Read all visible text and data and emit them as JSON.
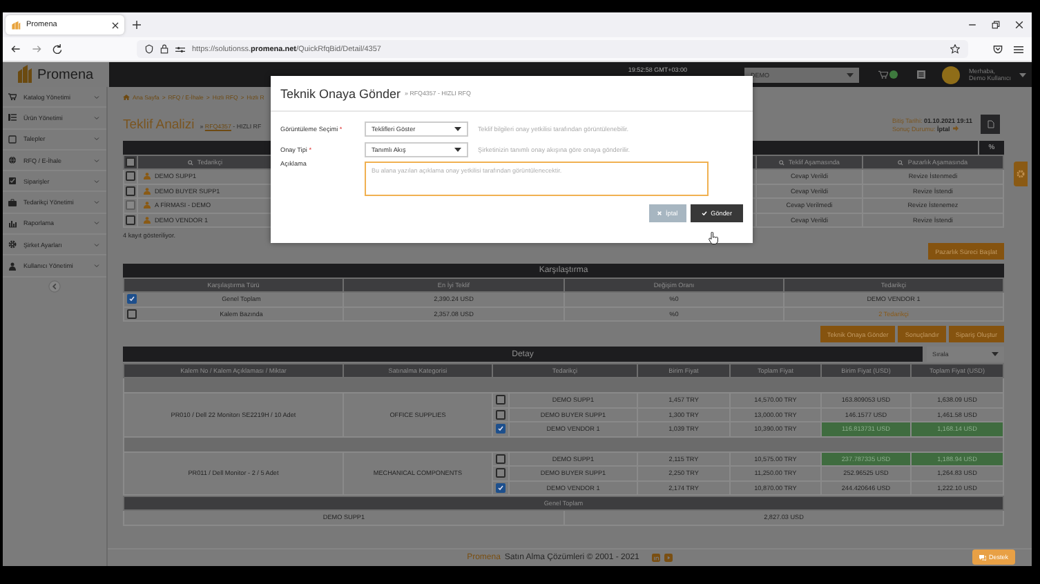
{
  "browser": {
    "tab_title": "Promena",
    "url": "https://solutionss.**promena.net**/QuickRfqBid/Detail/4357"
  },
  "header": {
    "logo": "Promena",
    "time": "19:52:58 GMT+03:00",
    "company_select": "DEMO",
    "greeting": "Merhaba,",
    "user": "Demo Kullanıcı"
  },
  "sidebar": {
    "items": [
      {
        "label": "Katalog Yönetimi"
      },
      {
        "label": "Ürün Yönetimi"
      },
      {
        "label": "Talepler"
      },
      {
        "label": "RFQ / E-İhale"
      },
      {
        "label": "Siparişler"
      },
      {
        "label": "Tedarikçi Yönetimi"
      },
      {
        "label": "Raporlama"
      },
      {
        "label": "Şirket Ayarları"
      },
      {
        "label": "Kullanıcı Yönetimi"
      }
    ]
  },
  "breadcrumb": {
    "separator": ">",
    "items": [
      "Ana Sayfa",
      "RFQ / E-İhale",
      "Hızlı RFQ",
      "Hızlı R"
    ]
  },
  "page": {
    "title": "Teklif Analizi",
    "subtitle_prefix": "»",
    "rfq_link": "RFQ4357",
    "subtitle_suffix": "- HIZLI RF",
    "end_date": "Bitiş Tarihi: **01.10.2021 19:11**",
    "result": "Sonuç Durumu: **İptal**"
  },
  "suppliers_table": {
    "percent_button": "%",
    "select_all_checked": false,
    "columns": [
      "Tedarikçi",
      "Teklif Aşamasında",
      "Pazarlık Aşamasında"
    ],
    "rows": [
      {
        "name": "DEMO SUPP1",
        "checked": false,
        "disabled": false,
        "offer_status": "Cevap Verildi",
        "negotiation_status": "Revize İstenmedi"
      },
      {
        "name": "DEMO BUYER SUPP1",
        "checked": false,
        "disabled": false,
        "offer_status": "Cevap Verildi",
        "negotiation_status": "Revize İstendi"
      },
      {
        "name": "A FİRMASI - DEMO",
        "checked": false,
        "disabled": true,
        "offer_status": "Cevap Verilmedi",
        "negotiation_status": "Revize İstenemez"
      },
      {
        "name": "DEMO VENDOR 1",
        "checked": false,
        "disabled": false,
        "offer_status": "Cevap Verildi",
        "negotiation_status": "Revize İstendi"
      }
    ],
    "record_count": "4 kayıt gösteriliyor."
  },
  "negotiation_button": "Pazarlık Süreci Başlat",
  "comparison": {
    "title": "Karşılaştırma",
    "columns": [
      "Karşılaştırma Türü",
      "En İyi Teklif",
      "Değişim Oranı",
      "Tedarikçi"
    ],
    "rows": [
      {
        "checked": true,
        "type": "Genel Toplam",
        "best_offer": "2,390.24 USD",
        "change": "%0",
        "supplier": "DEMO VENDOR 1",
        "kind": "text"
      },
      {
        "checked": false,
        "type": "Kalem Bazında",
        "best_offer": "2,357.08 USD",
        "change": "%0",
        "supplier": "2 Tedarikçi",
        "kind": "link"
      }
    ]
  },
  "actions": [
    "Teknik Onaya Gönder",
    "Sonuçlandır",
    "Sipariş Oluştur"
  ],
  "detail": {
    "title": "Detay",
    "sort_select": "Sırala",
    "columns": [
      "Kalem No / Kalem Açıklaması / Miktar",
      "Satınalma Kategorisi",
      "Tedarikçi",
      "Birim Fiyat",
      "Toplam Fiyat",
      "Birim Fiyat (USD)",
      "Toplam Fiyat (USD)"
    ],
    "groups": [
      {
        "item": "PR010 / Dell 22 Monitorı SE2219H / 10 Adet",
        "category": "OFFICE SUPPLIES",
        "offers": [
          {
            "supplier": "DEMO SUPP1",
            "checked": false,
            "unit_price": "1,457 TRY",
            "total_price": "14,570.00 TRY",
            "unit_price_usd": "163.809053 USD",
            "total_price_usd": "1,638.09 USD",
            "best": false
          },
          {
            "supplier": "DEMO BUYER SUPP1",
            "checked": false,
            "unit_price": "1,300 TRY",
            "total_price": "13,000.00 TRY",
            "unit_price_usd": "146.1577 USD",
            "total_price_usd": "1,461.58 USD",
            "best": false
          },
          {
            "supplier": "DEMO VENDOR 1",
            "checked": true,
            "unit_price": "1,039 TRY",
            "total_price": "10,390.00 TRY",
            "unit_price_usd": "116.813731 USD",
            "total_price_usd": "1,168.14 USD",
            "best": true
          }
        ]
      },
      {
        "item": "PR011 / Dell Monitor - 2 / 5 Adet",
        "category": "MECHANICAL COMPONENTS",
        "offers": [
          {
            "supplier": "DEMO SUPP1",
            "checked": false,
            "unit_price": "2,115 TRY",
            "total_price": "10,575.00 TRY",
            "unit_price_usd": "237.787335 USD",
            "total_price_usd": "1,188.94 USD",
            "best": true
          },
          {
            "supplier": "DEMO BUYER SUPP1",
            "checked": false,
            "unit_price": "2,250 TRY",
            "total_price": "11,250.00 TRY",
            "unit_price_usd": "252.96525 USD",
            "total_price_usd": "1,264.83 USD",
            "best": false
          },
          {
            "supplier": "DEMO VENDOR 1",
            "checked": true,
            "unit_price": "2,174 TRY",
            "total_price": "10,870.00 TRY",
            "unit_price_usd": "244.420646 USD",
            "total_price_usd": "1,222.10 USD",
            "best": false
          }
        ]
      }
    ],
    "totals_title": "Genel Toplam",
    "totals": [
      {
        "supplier": "DEMO SUPP1",
        "amount": "2,827.03 USD"
      }
    ]
  },
  "footer": {
    "brand": "Promena",
    "text": "Satın Alma Çözümleri © 2001 - 2021"
  },
  "support_button": "Destek",
  "modal": {
    "title": "Teknik Onaya Gönder",
    "subtitle": "» RFQ4357 - HIZLI RFQ",
    "fields": [
      {
        "kind": "select",
        "label": "Görüntüleme Seçimi",
        "required_mark": "*",
        "value": "Teklifleri Göster",
        "hint": "Teklif bilgileri onay yetkilisi tarafından görüntülenebilir."
      },
      {
        "kind": "select",
        "label": "Onay Tipi",
        "required_mark": "*",
        "value": "Tanımlı Akış",
        "hint": "Şirketinizin tanımlı onay akışına göre onaya gönderilir."
      },
      {
        "kind": "textarea",
        "label": "Açıklama",
        "placeholder": "Bu alana yazılan açıklama onay yetkilisi tarafından görüntülenecektir."
      }
    ],
    "buttons": [
      {
        "kind": "cancel",
        "label": "İptal"
      },
      {
        "kind": "submit",
        "label": "Gönder"
      }
    ]
  }
}
